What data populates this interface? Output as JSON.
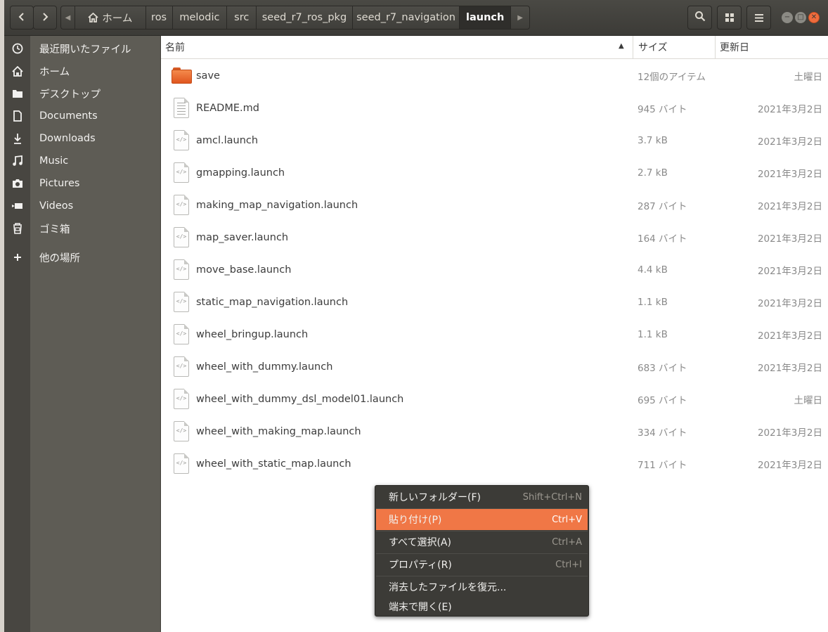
{
  "header": {
    "back_icon": "chevron-left-icon",
    "forward_icon": "chevron-right-icon",
    "path": [
      {
        "label": "ホーム",
        "icon": "home-icon"
      },
      {
        "label": "ros"
      },
      {
        "label": "melodic"
      },
      {
        "label": "src"
      },
      {
        "label": "seed_r7_ros_pkg"
      },
      {
        "label": "seed_r7_navigation"
      },
      {
        "label": "launch",
        "active": true
      }
    ],
    "buttons": [
      "search-icon",
      "view-grid-icon",
      "hamburger-menu-icon"
    ]
  },
  "sidebar": {
    "items": [
      {
        "label": "最近開いたファイル",
        "icon": "clock-icon"
      },
      {
        "label": "ホーム",
        "icon": "home-icon"
      },
      {
        "label": "デスクトップ",
        "icon": "folder-icon"
      },
      {
        "label": "Documents",
        "icon": "document-icon"
      },
      {
        "label": "Downloads",
        "icon": "download-icon"
      },
      {
        "label": "Music",
        "icon": "music-icon"
      },
      {
        "label": "Pictures",
        "icon": "camera-icon"
      },
      {
        "label": "Videos",
        "icon": "video-icon"
      },
      {
        "label": "ゴミ箱",
        "icon": "trash-icon"
      },
      {
        "label": "他の場所",
        "icon": "plus-icon"
      }
    ]
  },
  "columns": {
    "name": "名前",
    "size": "サイズ",
    "modified": "更新日"
  },
  "files": [
    {
      "name": "save",
      "size": "12個のアイテム",
      "date": "土曜日",
      "type": "folder"
    },
    {
      "name": "README.md",
      "size": "945 バイト",
      "date": "2021年3月2日",
      "type": "text"
    },
    {
      "name": "amcl.launch",
      "size": "3.7 kB",
      "date": "2021年3月2日",
      "type": "xml"
    },
    {
      "name": "gmapping.launch",
      "size": "2.7 kB",
      "date": "2021年3月2日",
      "type": "xml"
    },
    {
      "name": "making_map_navigation.launch",
      "size": "287 バイト",
      "date": "2021年3月2日",
      "type": "xml"
    },
    {
      "name": "map_saver.launch",
      "size": "164 バイト",
      "date": "2021年3月2日",
      "type": "xml"
    },
    {
      "name": "move_base.launch",
      "size": "4.4 kB",
      "date": "2021年3月2日",
      "type": "xml"
    },
    {
      "name": "static_map_navigation.launch",
      "size": "1.1 kB",
      "date": "2021年3月2日",
      "type": "xml"
    },
    {
      "name": "wheel_bringup.launch",
      "size": "1.1 kB",
      "date": "2021年3月2日",
      "type": "xml"
    },
    {
      "name": "wheel_with_dummy.launch",
      "size": "683 バイト",
      "date": "2021年3月2日",
      "type": "xml"
    },
    {
      "name": "wheel_with_dummy_dsl_model01.launch",
      "size": "695 バイト",
      "date": "土曜日",
      "type": "xml"
    },
    {
      "name": "wheel_with_making_map.launch",
      "size": "334 バイト",
      "date": "2021年3月2日",
      "type": "xml"
    },
    {
      "name": "wheel_with_static_map.launch",
      "size": "711 バイト",
      "date": "2021年3月2日",
      "type": "xml"
    }
  ],
  "context_menu": {
    "items": [
      {
        "label": "新しいフォルダー(F)",
        "accel": "Shift+Ctrl+N"
      },
      {
        "label": "貼り付け(P)",
        "accel": "Ctrl+V",
        "highlighted": true
      },
      {
        "label": "すべて選択(A)",
        "accel": "Ctrl+A"
      },
      {
        "label": "プロパティ(R)",
        "accel": "Ctrl+I"
      },
      {
        "label": "消去したファイルを復元...",
        "accel": ""
      },
      {
        "label": "端末で開く(E)",
        "accel": ""
      }
    ]
  },
  "colors": {
    "accent": "#f07746",
    "headerbar": "#3c3b37",
    "sidebar": "#5e5c55",
    "folder": "#e95420"
  }
}
